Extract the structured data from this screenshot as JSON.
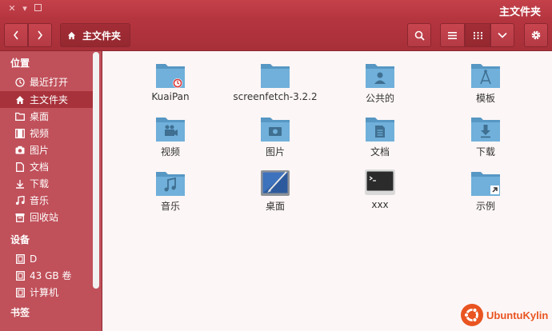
{
  "window": {
    "title": "主文件夹"
  },
  "toolbar": {
    "back_icon": "chevron-left-icon",
    "forward_icon": "chevron-right-icon",
    "location": "主文件夹",
    "search_icon": "search-icon",
    "list_view_icon": "list-icon",
    "grid_view_icon": "grid-icon",
    "menu_icon": "chevron-down-icon",
    "settings_icon": "gear-icon"
  },
  "sidebar": {
    "places_title": "位置",
    "places": [
      {
        "label": "最近打开",
        "icon": "clock-icon"
      },
      {
        "label": "主文件夹",
        "icon": "home-icon",
        "selected": true
      },
      {
        "label": "桌面",
        "icon": "folder-icon"
      },
      {
        "label": "视频",
        "icon": "video-icon"
      },
      {
        "label": "图片",
        "icon": "camera-icon"
      },
      {
        "label": "文档",
        "icon": "document-icon"
      },
      {
        "label": "下载",
        "icon": "download-icon"
      },
      {
        "label": "音乐",
        "icon": "music-icon"
      },
      {
        "label": "回收站",
        "icon": "trash-icon"
      }
    ],
    "devices_title": "设备",
    "devices": [
      {
        "label": "D",
        "icon": "drive-icon"
      },
      {
        "label": "43 GB 卷",
        "icon": "drive-icon"
      },
      {
        "label": "计算机",
        "icon": "drive-icon"
      }
    ],
    "bookmarks_title": "书签"
  },
  "files": [
    {
      "label": "KuaiPan",
      "icon": "kuaipan-folder-icon"
    },
    {
      "label": "screenfetch-3.2.2",
      "icon": "folder-icon"
    },
    {
      "label": "公共的",
      "icon": "public-folder-icon"
    },
    {
      "label": "模板",
      "icon": "templates-folder-icon"
    },
    {
      "label": "视频",
      "icon": "videos-folder-icon"
    },
    {
      "label": "图片",
      "icon": "pictures-folder-icon"
    },
    {
      "label": "文档",
      "icon": "documents-folder-icon"
    },
    {
      "label": "下载",
      "icon": "downloads-folder-icon"
    },
    {
      "label": "音乐",
      "icon": "music-folder-icon"
    },
    {
      "label": "桌面",
      "icon": "desktop-launcher-icon"
    },
    {
      "label": "xxx",
      "icon": "terminal-launcher-icon"
    },
    {
      "label": "示例",
      "icon": "examples-folder-icon"
    }
  ],
  "brand": {
    "text": "UbuntuKylin",
    "color": "#e95420"
  },
  "colors": {
    "accent": "#b5353f",
    "sidebar": "#c0505a",
    "folder": "#5fa3d0"
  }
}
